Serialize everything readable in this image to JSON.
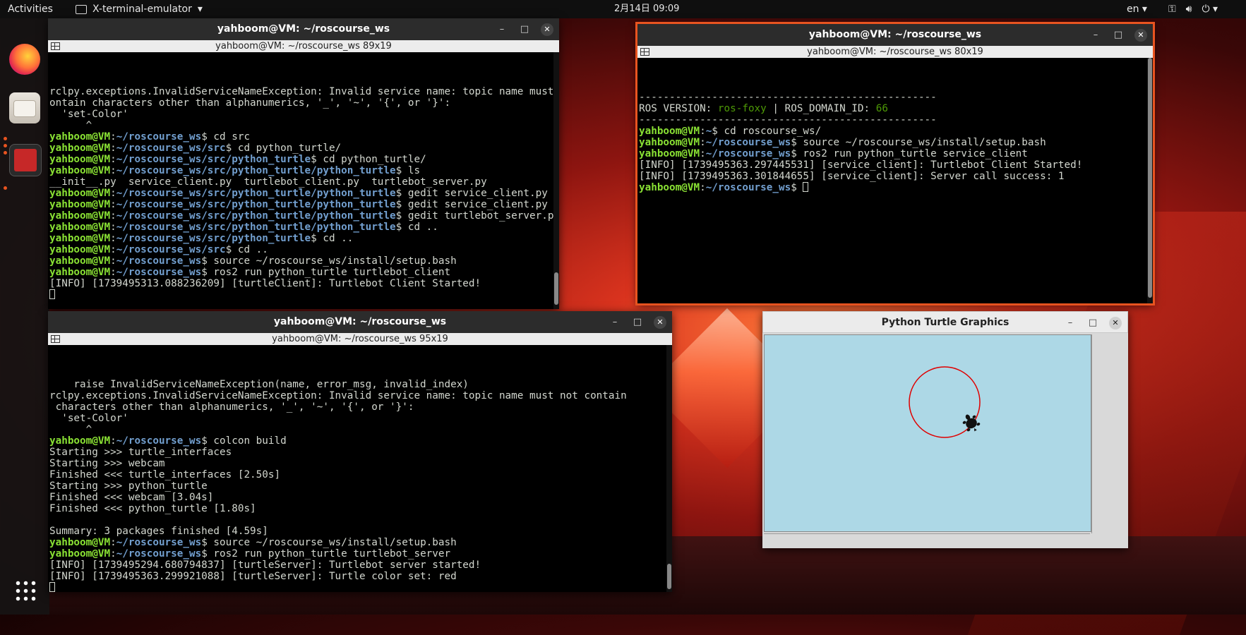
{
  "topbar": {
    "activities": "Activities",
    "app_name": "X-terminal-emulator",
    "app_caret": "▾",
    "clock": "2月14日  09:09",
    "lang": "en ▾",
    "tray_icons": [
      "network-icon",
      "volume-icon",
      "power-icon"
    ]
  },
  "dock": {
    "items": [
      "firefox",
      "files",
      "terminal",
      "show-applications"
    ]
  },
  "window_controls": {
    "minimize": "–",
    "maximize": "□",
    "close": "✕"
  },
  "win1": {
    "title": "yahboom@VM: ~/roscourse_ws",
    "subtitle": "yahboom@VM: ~/roscourse_ws 89x19",
    "lines": [
      {
        "t": "rclpy.exceptions.InvalidServiceNameException: Invalid service name: topic name must not c"
      },
      {
        "t": "ontain characters other than alphanumerics, '_', '~', '{', or '}':"
      },
      {
        "t": "  'set-Color'"
      },
      {
        "t": "      ^"
      },
      {
        "u": "yahboom@VM",
        "p": "~/roscourse_ws",
        "c": " cd src"
      },
      {
        "u": "yahboom@VM",
        "p": "~/roscourse_ws/src",
        "c": " cd python_turtle/"
      },
      {
        "u": "yahboom@VM",
        "p": "~/roscourse_ws/src/python_turtle",
        "c": " cd python_turtle/"
      },
      {
        "u": "yahboom@VM",
        "p": "~/roscourse_ws/src/python_turtle/python_turtle",
        "c": " ls"
      },
      {
        "t": "__init__.py  service_client.py  turtlebot_client.py  turtlebot_server.py"
      },
      {
        "u": "yahboom@VM",
        "p": "~/roscourse_ws/src/python_turtle/python_turtle",
        "c": " gedit service_client.py"
      },
      {
        "u": "yahboom@VM",
        "p": "~/roscourse_ws/src/python_turtle/python_turtle",
        "c": " gedit service_client.py"
      },
      {
        "u": "yahboom@VM",
        "p": "~/roscourse_ws/src/python_turtle/python_turtle",
        "c": " gedit turtlebot_server.py"
      },
      {
        "u": "yahboom@VM",
        "p": "~/roscourse_ws/src/python_turtle/python_turtle",
        "c": " cd .."
      },
      {
        "u": "yahboom@VM",
        "p": "~/roscourse_ws/src/python_turtle",
        "c": " cd .."
      },
      {
        "u": "yahboom@VM",
        "p": "~/roscourse_ws/src",
        "c": " cd .."
      },
      {
        "u": "yahboom@VM",
        "p": "~/roscourse_ws",
        "c": " source ~/roscourse_ws/install/setup.bash"
      },
      {
        "u": "yahboom@VM",
        "p": "~/roscourse_ws",
        "c": " ros2 run python_turtle turtlebot_client"
      },
      {
        "t": "[INFO] [1739495313.088236209] [turtleClient]: Turtlebot Client Started!"
      },
      {
        "cursor": true
      }
    ]
  },
  "win2": {
    "title": "yahboom@VM: ~/roscourse_ws",
    "subtitle": "yahboom@VM: ~/roscourse_ws 80x19",
    "lines": [
      {
        "t": "-------------------------------------------------"
      },
      {
        "k1": "ROS VERSION: ",
        "v1": "ros-foxy",
        "k2": " | ROS_DOMAIN_ID: ",
        "v2": "66"
      },
      {
        "t": "-------------------------------------------------"
      },
      {
        "u": "yahboom@VM",
        "p": "~",
        "c": " cd roscourse_ws/"
      },
      {
        "u": "yahboom@VM",
        "p": "~/roscourse_ws",
        "c": " source ~/roscourse_ws/install/setup.bash"
      },
      {
        "u": "yahboom@VM",
        "p": "~/roscourse_ws",
        "c": " ros2 run python_turtle service_client"
      },
      {
        "t": "[INFO] [1739495363.297445531] [service_client]: Turtlebot Client Started!"
      },
      {
        "t": "[INFO] [1739495363.301844655] [service_client]: Server call success: 1"
      },
      {
        "u": "yahboom@VM",
        "p": "~/roscourse_ws",
        "c": " ",
        "cursor": true
      }
    ]
  },
  "win3": {
    "title": "yahboom@VM: ~/roscourse_ws",
    "subtitle": "yahboom@VM: ~/roscourse_ws 95x19",
    "lines": [
      {
        "t": "    raise InvalidServiceNameException(name, error_msg, invalid_index)"
      },
      {
        "t": "rclpy.exceptions.InvalidServiceNameException: Invalid service name: topic name must not contain"
      },
      {
        "t": " characters other than alphanumerics, '_', '~', '{', or '}':"
      },
      {
        "t": "  'set-Color'"
      },
      {
        "t": "      ^"
      },
      {
        "u": "yahboom@VM",
        "p": "~/roscourse_ws",
        "c": " colcon build"
      },
      {
        "t": "Starting >>> turtle_interfaces"
      },
      {
        "t": "Starting >>> webcam"
      },
      {
        "t": "Finished <<< turtle_interfaces [2.50s]"
      },
      {
        "t": "Starting >>> python_turtle"
      },
      {
        "t": "Finished <<< webcam [3.04s]"
      },
      {
        "t": "Finished <<< python_turtle [1.80s]"
      },
      {
        "t": ""
      },
      {
        "t": "Summary: 3 packages finished [4.59s]"
      },
      {
        "u": "yahboom@VM",
        "p": "~/roscourse_ws",
        "c": " source ~/roscourse_ws/install/setup.bash"
      },
      {
        "u": "yahboom@VM",
        "p": "~/roscourse_ws",
        "c": " ros2 run python_turtle turtlebot_server"
      },
      {
        "t": "[INFO] [1739495294.680794837] [turtleServer]: Turtlebot server started!"
      },
      {
        "t": "[INFO] [1739495363.299921088] [turtleServer]: Turtle color set: red"
      },
      {
        "cursor": true
      }
    ]
  },
  "turtle_win": {
    "title": "Python Turtle Graphics",
    "pen_color": "#e00000",
    "canvas_color": "#add8e6"
  }
}
